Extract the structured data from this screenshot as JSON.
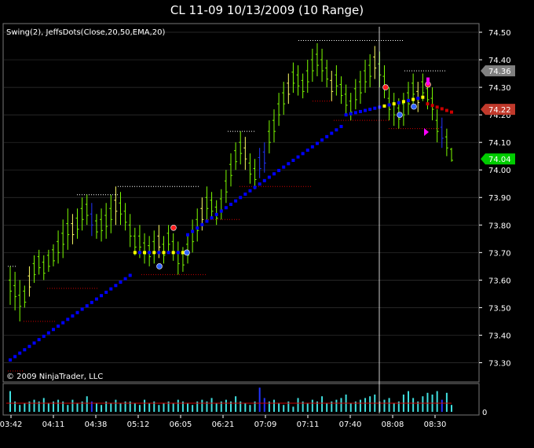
{
  "header": {
    "title": "CL 11-09  10/13/2009 (10 Range)"
  },
  "indicator_label": "Swing(2), JeffsDots(Close,20,50,EMA,20)",
  "copyright": "© 2009 NinjaTrader, LLC",
  "colors": {
    "up_bar": "#7CFC00",
    "down_bar": "#2233ff",
    "flat_bar": "#ffff66",
    "dot_blue": "#0000ff",
    "dot_yellow": "#ffff00",
    "dot_red": "#cc0000",
    "swing_high": "#ffffff",
    "swing_low": "#cc0000",
    "badge_red": "#c0392b",
    "badge_green": "#00cc00",
    "badge_gray": "#808080",
    "volume": "#40e0e0",
    "volume_down": "#2233ff",
    "volume_avg": "#cc0000",
    "marker_magenta": "#ff00ff"
  },
  "chart_data": {
    "type": "bar",
    "series_type": "ohlc",
    "ylim": [
      73.27,
      74.52
    ],
    "yticks": [
      "74.50",
      "74.40",
      "74.30",
      "74.20",
      "74.10",
      "74.00",
      "73.90",
      "73.80",
      "73.70",
      "73.60",
      "73.50",
      "73.40",
      "73.30"
    ],
    "xticks": [
      "03:42",
      "04:11",
      "04:38",
      "05:12",
      "06:05",
      "06:21",
      "07:09",
      "07:11",
      "07:40",
      "08:08",
      "08:30"
    ],
    "price_badges": [
      {
        "value": "74.36",
        "color": "gray"
      },
      {
        "value": "74.22",
        "color": "red"
      },
      {
        "value": "74.04",
        "color": "green"
      }
    ],
    "bars": [
      [
        73.65,
        73.51
      ],
      [
        73.63,
        73.49
      ],
      [
        73.6,
        73.45
      ],
      [
        73.58,
        73.5
      ],
      [
        73.65,
        73.54
      ],
      [
        73.69,
        73.59
      ],
      [
        73.71,
        73.62
      ],
      [
        73.69,
        73.6
      ],
      [
        73.71,
        73.63
      ],
      [
        73.73,
        73.65
      ],
      [
        73.78,
        73.66
      ],
      [
        73.82,
        73.68
      ],
      [
        73.86,
        73.71
      ],
      [
        73.84,
        73.73
      ],
      [
        73.86,
        73.75
      ],
      [
        73.9,
        73.78
      ],
      [
        73.91,
        73.8
      ],
      [
        73.88,
        73.76
      ],
      [
        73.84,
        73.75
      ],
      [
        73.86,
        73.74
      ],
      [
        73.88,
        73.75
      ],
      [
        73.91,
        73.77
      ],
      [
        73.94,
        73.8
      ],
      [
        73.92,
        73.8
      ],
      [
        73.88,
        73.78
      ],
      [
        73.84,
        73.72
      ],
      [
        73.79,
        73.69
      ],
      [
        73.8,
        73.68
      ],
      [
        73.77,
        73.66
      ],
      [
        73.76,
        73.65
      ],
      [
        73.78,
        73.66
      ],
      [
        73.8,
        73.68
      ],
      [
        73.76,
        73.66
      ],
      [
        73.8,
        73.7
      ],
      [
        73.77,
        73.67
      ],
      [
        73.74,
        73.62
      ],
      [
        73.72,
        73.63
      ],
      [
        73.76,
        73.66
      ],
      [
        73.82,
        73.7
      ],
      [
        73.86,
        73.74
      ],
      [
        73.9,
        73.78
      ],
      [
        73.94,
        73.82
      ],
      [
        73.92,
        73.82
      ],
      [
        73.89,
        73.8
      ],
      [
        73.93,
        73.82
      ],
      [
        74.0,
        73.88
      ],
      [
        74.06,
        73.94
      ],
      [
        74.1,
        74.0
      ],
      [
        74.14,
        74.02
      ],
      [
        74.12,
        74.0
      ],
      [
        74.06,
        73.95
      ],
      [
        74.04,
        73.93
      ],
      [
        74.08,
        73.97
      ],
      [
        74.1,
        73.99
      ],
      [
        74.18,
        74.06
      ],
      [
        74.22,
        74.1
      ],
      [
        74.28,
        74.16
      ],
      [
        74.32,
        74.2
      ],
      [
        74.35,
        74.24
      ],
      [
        74.39,
        74.28
      ],
      [
        74.38,
        74.27
      ],
      [
        74.35,
        74.26
      ],
      [
        74.4,
        74.28
      ],
      [
        74.44,
        74.32
      ],
      [
        74.46,
        74.34
      ],
      [
        74.44,
        74.32
      ],
      [
        74.4,
        74.3
      ],
      [
        74.36,
        74.25
      ],
      [
        74.38,
        74.27
      ],
      [
        74.34,
        74.24
      ],
      [
        74.31,
        74.2
      ],
      [
        74.28,
        74.18
      ],
      [
        74.33,
        74.22
      ],
      [
        74.36,
        74.24
      ],
      [
        74.4,
        74.28
      ],
      [
        74.42,
        74.3
      ],
      [
        74.45,
        74.33
      ],
      [
        74.43,
        74.3
      ],
      [
        74.38,
        74.26
      ],
      [
        74.3,
        74.18
      ],
      [
        74.28,
        74.16
      ],
      [
        74.26,
        74.15
      ],
      [
        74.28,
        74.16
      ],
      [
        74.32,
        74.2
      ],
      [
        74.35,
        74.24
      ],
      [
        74.32,
        74.21
      ],
      [
        74.35,
        74.25
      ],
      [
        74.33,
        74.22
      ],
      [
        74.3,
        74.18
      ],
      [
        74.22,
        74.1
      ],
      [
        74.19,
        74.08
      ],
      [
        74.15,
        74.05
      ],
      [
        74.08,
        74.03
      ]
    ],
    "volume": [
      12,
      6,
      4,
      5,
      6,
      7,
      6,
      8,
      5,
      6,
      7,
      6,
      4,
      7,
      5,
      6,
      9,
      6,
      5,
      4,
      6,
      5,
      7,
      5,
      6,
      6,
      5,
      4,
      7,
      5,
      6,
      4,
      5,
      6,
      5,
      7,
      6,
      5,
      4,
      6,
      7,
      6,
      8,
      5,
      6,
      7,
      6,
      9,
      6,
      5,
      4,
      6,
      14,
      8,
      6,
      7,
      5,
      4,
      6,
      3,
      8,
      6,
      5,
      7,
      6,
      9,
      5,
      6,
      7,
      8,
      10,
      5,
      6,
      7,
      8,
      9,
      10,
      6,
      7,
      8,
      5,
      6,
      10,
      12,
      8,
      6,
      9,
      11,
      10,
      12,
      7,
      11,
      4
    ]
  }
}
